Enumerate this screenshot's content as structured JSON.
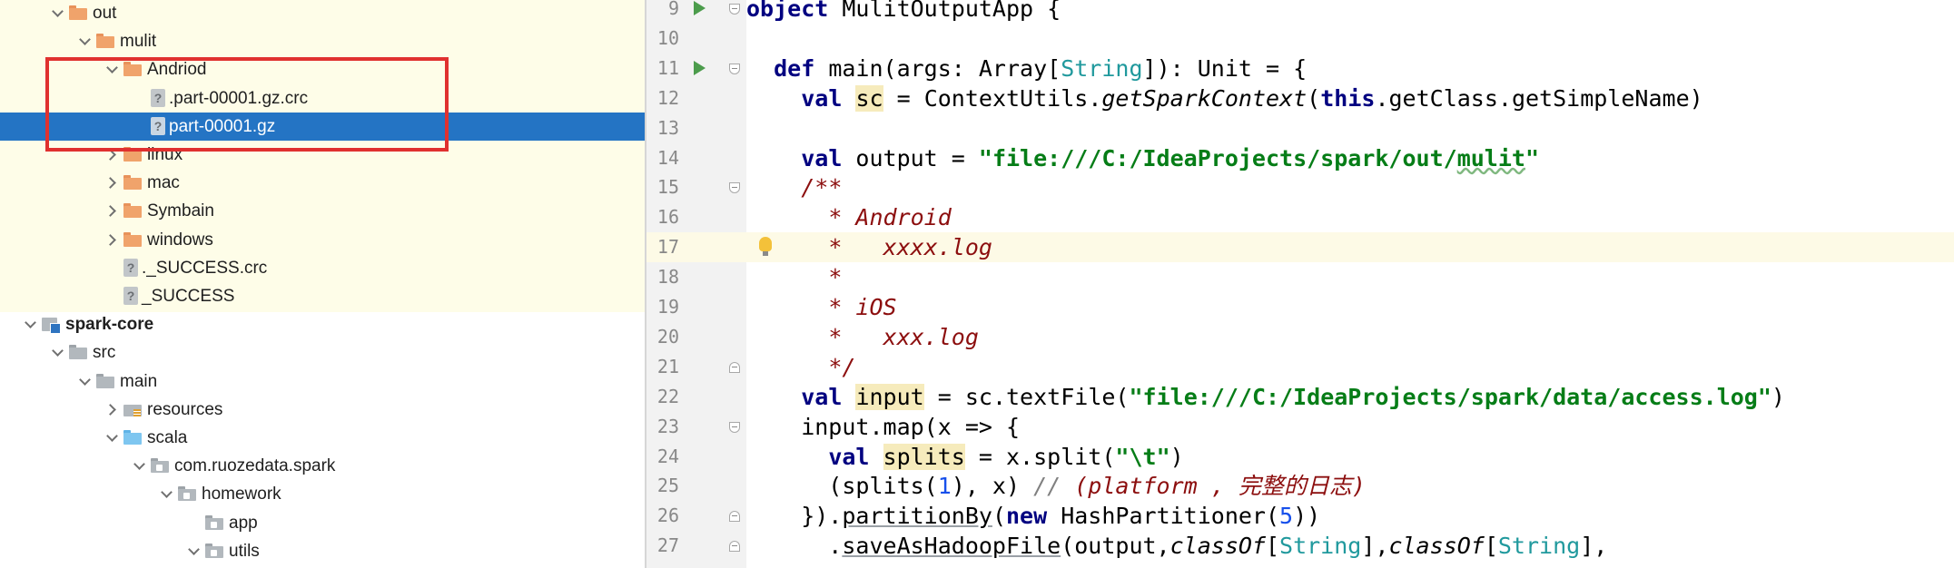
{
  "project_tree": {
    "items": [
      {
        "label": "out",
        "depth": 1,
        "state": "open",
        "icon": "folder-orange-icon",
        "bold": false,
        "selected": false
      },
      {
        "label": "mulit",
        "depth": 2,
        "state": "open",
        "icon": "folder-orange-icon",
        "bold": false,
        "selected": false
      },
      {
        "label": "Andriod",
        "depth": 3,
        "state": "open",
        "icon": "folder-orange-icon",
        "bold": false,
        "selected": false
      },
      {
        "label": ".part-00001.gz.crc",
        "depth": 4,
        "state": "none",
        "icon": "unknown-file-icon",
        "bold": false,
        "selected": false
      },
      {
        "label": "part-00001.gz",
        "depth": 4,
        "state": "none",
        "icon": "unknown-file-icon",
        "bold": false,
        "selected": true
      },
      {
        "label": "linux",
        "depth": 3,
        "state": "closed",
        "icon": "folder-orange-icon",
        "bold": false,
        "selected": false
      },
      {
        "label": "mac",
        "depth": 3,
        "state": "closed",
        "icon": "folder-orange-icon",
        "bold": false,
        "selected": false
      },
      {
        "label": "Symbain",
        "depth": 3,
        "state": "closed",
        "icon": "folder-orange-icon",
        "bold": false,
        "selected": false
      },
      {
        "label": "windows",
        "depth": 3,
        "state": "closed",
        "icon": "folder-orange-icon",
        "bold": false,
        "selected": false
      },
      {
        "label": "._SUCCESS.crc",
        "depth": 3,
        "state": "none",
        "icon": "unknown-file-icon",
        "bold": false,
        "selected": false
      },
      {
        "label": "_SUCCESS",
        "depth": 3,
        "state": "none",
        "icon": "unknown-file-icon",
        "bold": false,
        "selected": false
      },
      {
        "label": "spark-core",
        "depth": 0,
        "state": "open",
        "icon": "module-icon",
        "bold": true,
        "selected": false
      },
      {
        "label": "src",
        "depth": 1,
        "state": "open",
        "icon": "folder-gray-icon",
        "bold": false,
        "selected": false
      },
      {
        "label": "main",
        "depth": 2,
        "state": "open",
        "icon": "folder-gray-icon",
        "bold": false,
        "selected": false
      },
      {
        "label": "resources",
        "depth": 3,
        "state": "closed",
        "icon": "resources-folder-icon",
        "bold": false,
        "selected": false
      },
      {
        "label": "scala",
        "depth": 3,
        "state": "open",
        "icon": "folder-blue-icon",
        "bold": false,
        "selected": false
      },
      {
        "label": "com.ruozedata.spark",
        "depth": 4,
        "state": "open",
        "icon": "package-icon",
        "bold": false,
        "selected": false
      },
      {
        "label": "homework",
        "depth": 5,
        "state": "open",
        "icon": "package-icon",
        "bold": false,
        "selected": false
      },
      {
        "label": "app",
        "depth": 6,
        "state": "none",
        "icon": "package-icon",
        "bold": false,
        "selected": false
      },
      {
        "label": "utils",
        "depth": 6,
        "state": "open",
        "icon": "package-icon",
        "bold": false,
        "selected": false
      }
    ]
  },
  "editor": {
    "current_line": "17",
    "lines": [
      {
        "n": "9",
        "run": true,
        "fold": "top",
        "tokens": [
          [
            "kw",
            "object"
          ],
          [
            "p",
            " MulitOutputApp {"
          ]
        ]
      },
      {
        "n": "10",
        "run": false,
        "fold": "",
        "tokens": []
      },
      {
        "n": "11",
        "run": true,
        "fold": "top",
        "tokens": [
          [
            "p",
            "  "
          ],
          [
            "kw",
            "def"
          ],
          [
            "p",
            " main(args: Array["
          ],
          [
            "type",
            "String"
          ],
          [
            "p",
            "]): Unit = {"
          ]
        ]
      },
      {
        "n": "12",
        "run": false,
        "fold": "",
        "tokens": [
          [
            "p",
            "    "
          ],
          [
            "kw",
            "val"
          ],
          [
            "p",
            " "
          ],
          [
            "hl",
            "sc"
          ],
          [
            "p",
            " = ContextUtils."
          ],
          [
            "meth",
            "getSparkContext"
          ],
          [
            "p",
            "("
          ],
          [
            "kw",
            "this"
          ],
          [
            "p",
            ".getClass.getSimpleName)"
          ]
        ]
      },
      {
        "n": "13",
        "run": false,
        "fold": "",
        "tokens": []
      },
      {
        "n": "14",
        "run": false,
        "fold": "",
        "tokens": [
          [
            "p",
            "    "
          ],
          [
            "kw",
            "val"
          ],
          [
            "p",
            " output = "
          ],
          [
            "str",
            "\"file:///C:/IdeaProjects/spark/out/"
          ],
          [
            "strw",
            "mulit"
          ],
          [
            "str",
            "\""
          ]
        ]
      },
      {
        "n": "15",
        "run": false,
        "fold": "top",
        "tokens": [
          [
            "p",
            "    "
          ],
          [
            "cmt",
            "/**"
          ]
        ]
      },
      {
        "n": "16",
        "run": false,
        "fold": "",
        "tokens": [
          [
            "p",
            "    "
          ],
          [
            "cmt",
            "  * Android"
          ]
        ]
      },
      {
        "n": "17",
        "run": false,
        "fold": "",
        "bulb": true,
        "tokens": [
          [
            "p",
            "    "
          ],
          [
            "cmt",
            "  *   xxxx.log"
          ]
        ]
      },
      {
        "n": "18",
        "run": false,
        "fold": "",
        "tokens": [
          [
            "p",
            "    "
          ],
          [
            "cmt",
            "  *"
          ]
        ]
      },
      {
        "n": "19",
        "run": false,
        "fold": "",
        "tokens": [
          [
            "p",
            "    "
          ],
          [
            "cmt",
            "  * iOS"
          ]
        ]
      },
      {
        "n": "20",
        "run": false,
        "fold": "",
        "tokens": [
          [
            "p",
            "    "
          ],
          [
            "cmt",
            "  *   xxx.log"
          ]
        ]
      },
      {
        "n": "21",
        "run": false,
        "fold": "bot",
        "tokens": [
          [
            "p",
            "    "
          ],
          [
            "cmt",
            "  */"
          ]
        ]
      },
      {
        "n": "22",
        "run": false,
        "fold": "",
        "tokens": [
          [
            "p",
            "    "
          ],
          [
            "kw",
            "val"
          ],
          [
            "p",
            " "
          ],
          [
            "hl",
            "input"
          ],
          [
            "p",
            " = sc.textFile("
          ],
          [
            "str",
            "\"file:///C:/IdeaProjects/spark/data/access.log\""
          ],
          [
            "p",
            ")"
          ]
        ]
      },
      {
        "n": "23",
        "run": false,
        "fold": "top",
        "tokens": [
          [
            "p",
            "    input.map(x => {"
          ]
        ]
      },
      {
        "n": "24",
        "run": false,
        "fold": "",
        "tokens": [
          [
            "p",
            "      "
          ],
          [
            "kw",
            "val"
          ],
          [
            "p",
            " "
          ],
          [
            "hl",
            "splits"
          ],
          [
            "p",
            " = x.split("
          ],
          [
            "str",
            "\"\\t\""
          ],
          [
            "p",
            ")"
          ]
        ]
      },
      {
        "n": "25",
        "run": false,
        "fold": "",
        "tokens": [
          [
            "p",
            "      (splits("
          ],
          [
            "num",
            "1"
          ],
          [
            "p",
            "), x) "
          ],
          [
            "lcmt",
            "// "
          ],
          [
            "cmt",
            "(platform , 完整的日志)"
          ]
        ]
      },
      {
        "n": "26",
        "run": false,
        "fold": "bot",
        "tokens": [
          [
            "p",
            "    })."
          ],
          [
            "ul",
            "partitionBy"
          ],
          [
            "p",
            "("
          ],
          [
            "kw",
            "new"
          ],
          [
            "p",
            " HashPartitioner("
          ],
          [
            "num",
            "5"
          ],
          [
            "p",
            "))"
          ]
        ]
      },
      {
        "n": "27",
        "run": false,
        "fold": "bot",
        "tokens": [
          [
            "p",
            "      ."
          ],
          [
            "ul",
            "saveAsHadoopFile"
          ],
          [
            "p",
            "(output,"
          ],
          [
            "meth",
            "classOf"
          ],
          [
            "p",
            "["
          ],
          [
            "type",
            "String"
          ],
          [
            "p",
            "],"
          ],
          [
            "meth",
            "classOf"
          ],
          [
            "p",
            "["
          ],
          [
            "type",
            "String"
          ],
          [
            "p",
            "],"
          ]
        ]
      }
    ]
  },
  "colors": {
    "selection": "#2474c4",
    "highlight_box": "#e0312f",
    "tree_highlight_bg": "#fefde8",
    "keyword": "#000080",
    "string": "#067d17",
    "comment": "#8c0e0e"
  }
}
